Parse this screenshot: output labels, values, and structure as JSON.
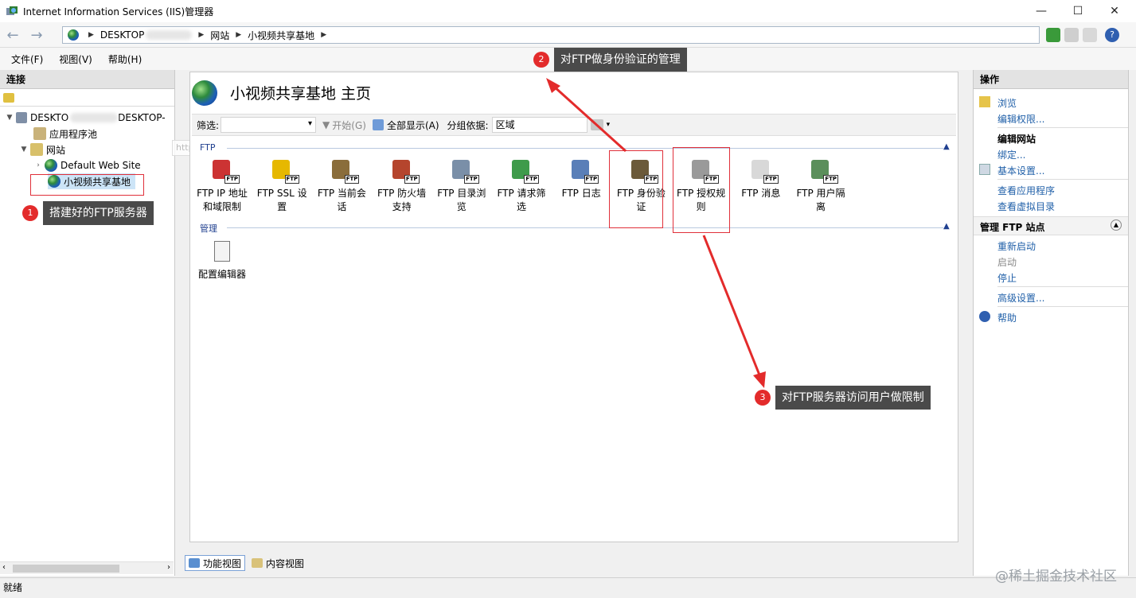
{
  "window": {
    "title": "Internet Information Services (IIS)管理器",
    "minimize": "—",
    "maximize": "☐",
    "close": "✕"
  },
  "address": {
    "host": "DESKTOP",
    "site_group": "网站",
    "site": "小视频共享基地"
  },
  "menu": [
    "文件(F)",
    "视图(V)",
    "帮助(H)"
  ],
  "connections": {
    "header": "连接",
    "tree": {
      "server": "DESKTO",
      "server_suffix": "DESKTOP-",
      "app_pools": "应用程序池",
      "sites": "网站",
      "default_site": "Default Web Site",
      "ftp_site": "小视频共享基地"
    },
    "tooltip": "http://localhost/"
  },
  "main": {
    "title": "小视频共享基地 主页",
    "filter_label": "筛选:",
    "start_button": "开始(G)",
    "show_all_button": "全部显示(A)",
    "group_by_label": "分组依据:",
    "group_by_value": "区域",
    "section_ftp": "FTP",
    "section_manage": "管理",
    "features": [
      {
        "line1": "FTP IP 地址",
        "line2": "和域限制"
      },
      {
        "line1": "FTP SSL 设",
        "line2": "置"
      },
      {
        "line1": "FTP 当前会",
        "line2": "话"
      },
      {
        "line1": "FTP 防火墙",
        "line2": "支持"
      },
      {
        "line1": "FTP 目录浏",
        "line2": "览"
      },
      {
        "line1": "FTP 请求筛",
        "line2": "选"
      },
      {
        "line1": "FTP 日志",
        "line2": ""
      },
      {
        "line1": "FTP 身份验",
        "line2": "证"
      },
      {
        "line1": "FTP 授权规",
        "line2": "则"
      },
      {
        "line1": "FTP 消息",
        "line2": ""
      },
      {
        "line1": "FTP 用户隔",
        "line2": "离"
      }
    ],
    "ftp_badge": "FTP",
    "manage_features": [
      {
        "line1": "配置编辑器"
      }
    ],
    "view_tabs": [
      "功能视图",
      "内容视图"
    ]
  },
  "actions": {
    "header": "操作",
    "browse": "浏览",
    "edit_permissions": "编辑权限...",
    "edit_site": "编辑网站",
    "bindings": "绑定...",
    "basic_settings": "基本设置...",
    "view_apps": "查看应用程序",
    "view_vdirs": "查看虚拟目录",
    "manage_ftp": "管理 FTP 站点",
    "restart": "重新启动",
    "start": "启动",
    "stop": "停止",
    "advanced": "高级设置...",
    "help": "帮助"
  },
  "status": "就绪",
  "watermark": "@稀土掘金技术社区",
  "annotations": [
    {
      "num": "1",
      "text": "搭建好的FTP服务器"
    },
    {
      "num": "2",
      "text": "对FTP做身份验证的管理"
    },
    {
      "num": "3",
      "text": "对FTP服务器访问用户做限制"
    }
  ],
  "colors": {
    "link": "#1f5fa8",
    "annotation_red": "#e32b2b",
    "callout_bg": "#4a4a4a"
  }
}
